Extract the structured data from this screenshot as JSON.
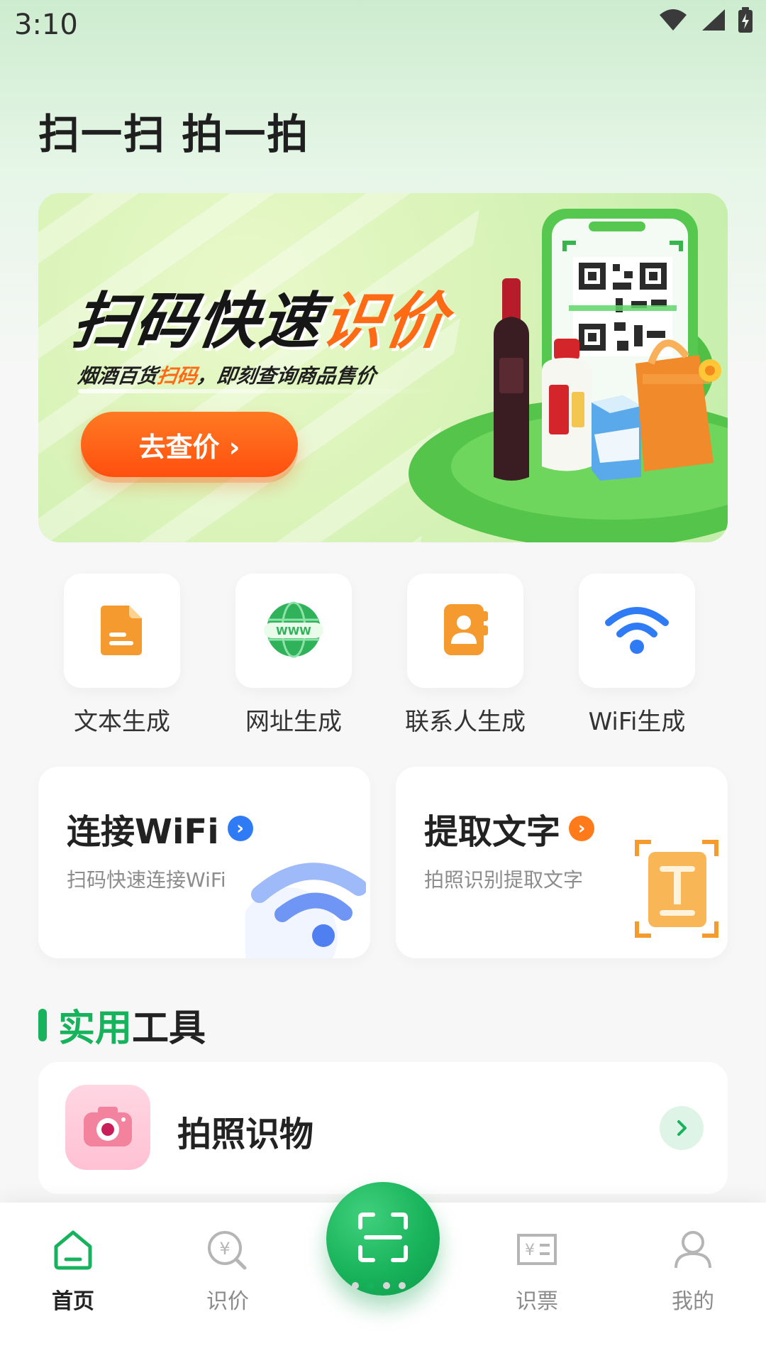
{
  "status_bar": {
    "time": "3:10",
    "icons": [
      "wifi-icon",
      "cellular-signal-icon",
      "battery-charging-icon"
    ]
  },
  "header": {
    "title": "扫一扫 拍一拍"
  },
  "banner": {
    "headline_main": "扫码快速",
    "headline_accent": "识价",
    "subtitle_part1": "烟酒百货",
    "subtitle_accent": "扫码",
    "subtitle_part2": "，即刻查询商品售价",
    "cta_label": "去查价 ›"
  },
  "shortcuts": [
    {
      "label": "文本生成",
      "icon": "document-icon"
    },
    {
      "label": "网址生成",
      "icon": "globe-www-icon"
    },
    {
      "label": "联系人生成",
      "icon": "contact-book-icon"
    },
    {
      "label": "WiFi生成",
      "icon": "wifi-icon"
    }
  ],
  "cards": {
    "wifi": {
      "title": "连接WiFi",
      "subtitle": "扫码快速连接WiFi"
    },
    "ocr": {
      "title": "提取文字",
      "subtitle": "拍照识别提取文字"
    }
  },
  "section": {
    "title_accent": "实用",
    "title_rest": "工具"
  },
  "tools": [
    {
      "label": "拍照识物",
      "icon": "camera-icon"
    }
  ],
  "bottom_nav": {
    "items": [
      {
        "label": "首页",
        "icon": "home-icon",
        "active": true
      },
      {
        "label": "识价",
        "icon": "price-search-icon",
        "active": false
      },
      {
        "label": "识票",
        "icon": "receipt-icon",
        "active": false
      },
      {
        "label": "我的",
        "icon": "user-icon",
        "active": false
      }
    ],
    "scan_icon": "scan-icon"
  },
  "colors": {
    "brand_green": "#16b25c",
    "accent_orange": "#ff6a14",
    "accent_blue": "#2f7bf6"
  }
}
